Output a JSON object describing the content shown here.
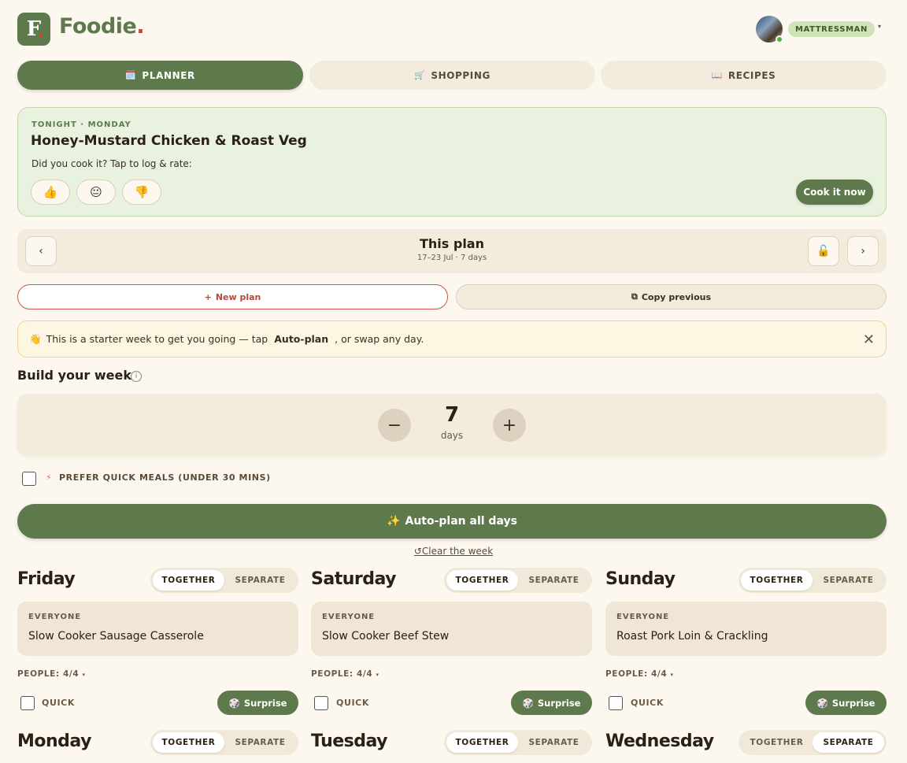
{
  "brand": {
    "logo_letter": "F",
    "name": "Foodie",
    "dot": "."
  },
  "user": {
    "name": "MATTRESSMAN",
    "caret": "▾"
  },
  "tabs": [
    {
      "icon": "🗓️",
      "label": "PLANNER"
    },
    {
      "icon": "🛒",
      "label": "SHOPPING"
    },
    {
      "icon": "📖",
      "label": "RECIPES"
    }
  ],
  "tonight": {
    "eyebrow": "TONIGHT · MONDAY",
    "title": "Honey-Mustard Chicken & Roast Veg",
    "prompt": "Did you cook it? Tap to log & rate:",
    "reactions": [
      "👍",
      "😐",
      "👎"
    ],
    "cook_label": "Cook it now"
  },
  "plan": {
    "prev": "‹",
    "next": "›",
    "lock": "🔓",
    "title": "This plan",
    "subtitle": "17–23 Jul · 7 days"
  },
  "actions": {
    "new_plan": "New plan",
    "new_plan_icon": "+",
    "copy_previous": "Copy previous",
    "copy_icon": "⧉"
  },
  "banner": {
    "icon": "👋",
    "before": "This is a starter week to get you going — tap",
    "bold": "Auto-plan",
    "after": ", or swap any day.",
    "close": "✕"
  },
  "build": {
    "title": "Build your week",
    "info": "i",
    "minus": "−",
    "plus": "+",
    "days_count": "7",
    "days_unit": "days",
    "prefer_quick": "PREFER QUICK MEALS (UNDER 30 MINS)",
    "bolt": "⚡"
  },
  "autoplan": {
    "icon": "✨",
    "label": "Auto-plan all days"
  },
  "clear": {
    "icon": "↺",
    "label": "Clear the week"
  },
  "segment": {
    "together": "TOGETHER",
    "separate": "SEPARATE"
  },
  "days": [
    {
      "name": "Friday",
      "mode": "together",
      "eyebrow": "EVERYONE",
      "meal": "Slow Cooker Sausage Casserole",
      "people": "PEOPLE: 4/4",
      "quick": "QUICK",
      "surprise": "Surprise"
    },
    {
      "name": "Saturday",
      "mode": "together",
      "eyebrow": "EVERYONE",
      "meal": "Slow Cooker Beef Stew",
      "people": "PEOPLE: 4/4",
      "quick": "QUICK",
      "surprise": "Surprise"
    },
    {
      "name": "Sunday",
      "mode": "together",
      "eyebrow": "EVERYONE",
      "meal": "Roast Pork Loin & Crackling",
      "people": "PEOPLE: 4/4",
      "quick": "QUICK",
      "surprise": "Surprise"
    },
    {
      "name": "Monday",
      "mode": "together"
    },
    {
      "name": "Tuesday",
      "mode": "together"
    },
    {
      "name": "Wednesday",
      "mode": "separate"
    }
  ],
  "people_caret": "▾",
  "surprise_icon": "🎲",
  "colors": {
    "accent": "#5e7a4c",
    "background": "#fcf8f0",
    "danger": "#c9574c"
  }
}
